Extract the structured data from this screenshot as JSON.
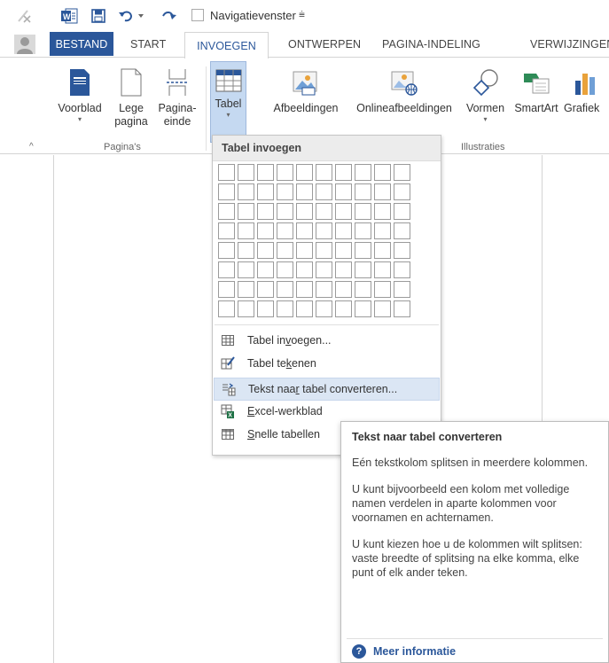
{
  "quick_access": {
    "nav_pane_label": "Navigatievenster",
    "more_glyph": "⩧"
  },
  "tabs": [
    {
      "label": "BESTAND"
    },
    {
      "label": "START"
    },
    {
      "label": "INVOEGEN"
    },
    {
      "label": "ONTWERPEN"
    },
    {
      "label": "PAGINA-INDELING"
    },
    {
      "label": "VERWIJZINGEN"
    }
  ],
  "ribbon": {
    "buttons": {
      "voorblad": {
        "label": "Voorblad",
        "caret": "▾"
      },
      "lege_pagina": {
        "label1": "Lege",
        "label2": "pagina"
      },
      "pagina_einde": {
        "label1": "Pagina-",
        "label2": "einde"
      },
      "tabel": {
        "label": "Tabel",
        "caret": "▾"
      },
      "afbeeldingen": {
        "label": "Afbeeldingen"
      },
      "onlineafbeeldingen": {
        "label": "Onlineafbeeldingen"
      },
      "vormen": {
        "label": "Vormen",
        "caret": "▾"
      },
      "smartart": {
        "label": "SmartArt"
      },
      "grafiek": {
        "label": "Grafiek"
      }
    },
    "groups": {
      "paginas": "Pagina's",
      "illustraties": "Illustraties"
    },
    "collapse_glyph": "^"
  },
  "dropdown": {
    "header": "Tabel invoegen",
    "grid": {
      "columns": 10,
      "rows": 8
    },
    "items": {
      "tabel_invoegen": {
        "pre": "Tabel in",
        "key": "v",
        "post": "oegen..."
      },
      "tabel_tekenen": {
        "pre": "Tabel te",
        "key": "k",
        "post": "enen"
      },
      "tekst_naar_tabel": {
        "pre": "Tekst naa",
        "key": "r",
        "post": " tabel converteren..."
      },
      "excel_werkblad": {
        "pre": "",
        "key": "E",
        "post": "xcel-werkblad"
      },
      "snelle_tabellen": {
        "pre": "",
        "key": "S",
        "post": "nelle tabellen"
      }
    }
  },
  "tooltip": {
    "title": "Tekst naar tabel converteren",
    "paragraphs": [
      "Eén tekstkolom splitsen in meerdere kolommen.",
      "U kunt bijvoorbeeld een kolom met volledige namen verdelen in aparte kolommen voor voornamen en achternamen.",
      "U kunt kiezen hoe u de kolommen wilt splitsen: vaste breedte of splitsing na elke komma, elke punt of elk ander teken."
    ],
    "more_info": "Meer informatie",
    "more_info_icon": "?"
  },
  "colors": {
    "accent": "#2b579a",
    "hover": "#dbe6f4",
    "pressed": "#c5d9f1"
  }
}
